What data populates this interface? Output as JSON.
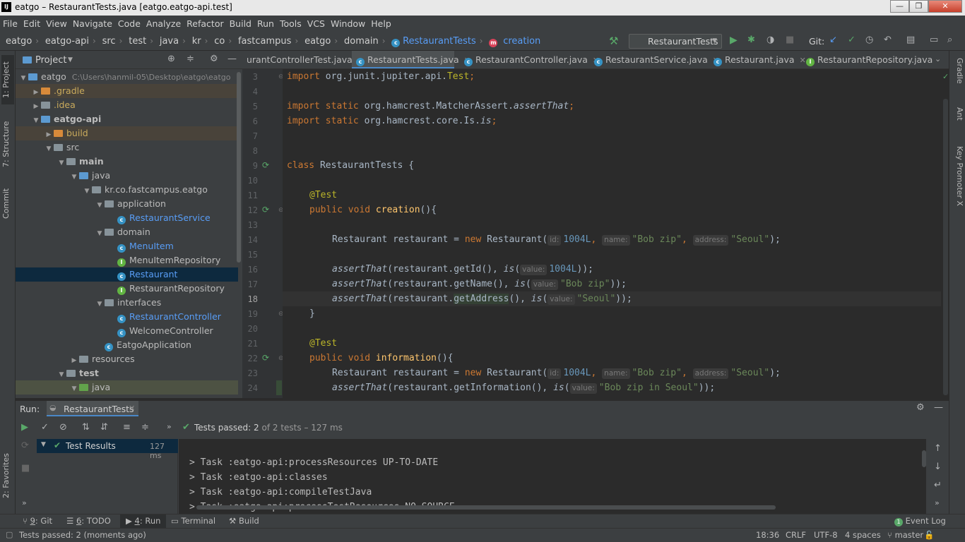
{
  "titlebar": {
    "logo": "IJ",
    "title": "eatgo – RestaurantTests.java [eatgo.eatgo-api.test]",
    "min": "—",
    "max": "❐",
    "close": "✕"
  },
  "menu": [
    "File",
    "Edit",
    "View",
    "Navigate",
    "Code",
    "Analyze",
    "Refactor",
    "Build",
    "Run",
    "Tools",
    "VCS",
    "Window",
    "Help"
  ],
  "breadcrumbs": [
    "eatgo",
    "eatgo-api",
    "src",
    "test",
    "java",
    "kr",
    "co",
    "fastcampus",
    "eatgo",
    "domain",
    "RestaurantTests",
    "creation"
  ],
  "run_config": "RestaurantTests",
  "git_label": "Git:",
  "project_panel": {
    "title": "Project",
    "root_path": "C:\\Users\\hanmil-05\\Desktop\\eatgo\\eatgo",
    "tree": [
      {
        "label": "eatgo",
        "path": "C:\\Users\\hanmil-05\\Desktop\\eatgo\\eatgo"
      },
      {
        "label": ".gradle"
      },
      {
        "label": ".idea"
      },
      {
        "label": "eatgo-api"
      },
      {
        "label": "build"
      },
      {
        "label": "src"
      },
      {
        "label": "main"
      },
      {
        "label": "java"
      },
      {
        "label": "kr.co.fastcampus.eatgo"
      },
      {
        "label": "application"
      },
      {
        "label": "RestaurantService"
      },
      {
        "label": "domain"
      },
      {
        "label": "MenuItem"
      },
      {
        "label": "MenuItemRepository"
      },
      {
        "label": "Restaurant"
      },
      {
        "label": "RestaurantRepository"
      },
      {
        "label": "interfaces"
      },
      {
        "label": "RestaurantController"
      },
      {
        "label": "WelcomeController"
      },
      {
        "label": "EatgoApplication"
      },
      {
        "label": "resources"
      },
      {
        "label": "test"
      },
      {
        "label": "java"
      }
    ]
  },
  "left_tabs": {
    "project": "1: Project",
    "structure": "7: Structure",
    "commit": "Commit",
    "favorites": "2: Favorites"
  },
  "right_tabs": {
    "gradle": "Gradle",
    "ant": "Ant",
    "key_promoter": "Key Promoter X"
  },
  "tabs": [
    {
      "label": "urantControllerTest.java"
    },
    {
      "label": "RestaurantTests.java"
    },
    {
      "label": "RestaurantController.java"
    },
    {
      "label": "RestaurantService.java"
    },
    {
      "label": "Restaurant.java"
    },
    {
      "label": "RestaurantRepository.java"
    }
  ],
  "code": {
    "line_numbers": [
      "3",
      "4",
      "5",
      "6",
      "7",
      "8",
      "9",
      "10",
      "11",
      "12",
      "13",
      "14",
      "15",
      "16",
      "17",
      "18",
      "19",
      "20",
      "21",
      "22",
      "23",
      "24"
    ],
    "l3": {
      "kw": "import",
      "rest": " org.junit.jupiter.api.",
      "cls": "Test",
      ";": ";"
    },
    "l5": {
      "kw": "import static",
      "rest": " org.hamcrest.MatcherAssert.",
      "m": "assertThat",
      ";": ";"
    },
    "l6": {
      "kw": "import static",
      "rest": " org.hamcrest.core.Is.",
      "m": "is",
      ";": ";"
    },
    "l9": {
      "kw": "class",
      "rest": " RestaurantTests {"
    },
    "ann": "@Test",
    "l12": {
      "kw": "public void",
      "fn": " creation",
      "rest": "(){"
    },
    "l14": {
      "a": "Restaurant restaurant = ",
      "kw": "new",
      "b": " Restaurant(",
      "h1": "id:",
      "n1": "1004L",
      "c": ", ",
      "h2": "name:",
      "s1": "\"Bob zip\"",
      "d": ", ",
      "h3": "address:",
      "s2": "\"Seoul\"",
      "e": ");"
    },
    "l16": {
      "m": "assertThat",
      "a": "(restaurant.getId(), ",
      "m2": "is",
      "b": "(",
      "h": "value:",
      "v": "1004L",
      "c": "));"
    },
    "l17": {
      "m": "assertThat",
      "a": "(restaurant.getName(), ",
      "m2": "is",
      "b": "(",
      "h": "value:",
      "v": "\"Bob zip\"",
      "c": "));"
    },
    "l18": {
      "m": "assertThat",
      "a": "(restaurant.",
      "g": "getAddress",
      "a2": "(), ",
      "m2": "is",
      "b": "(",
      "h": "value:",
      "v": "\"Seoul\"",
      "c": "));"
    },
    "l19": "}",
    "l22": {
      "kw": "public void",
      "fn": " information",
      "rest": "(){"
    },
    "l23": {
      "a": "Restaurant restaurant = ",
      "kw": "new",
      "b": " Restaurant(",
      "h1": "id:",
      "n1": "1004L",
      "c": ", ",
      "h2": "name:",
      "s1": "\"Bob zip\"",
      "d": ", ",
      "h3": "address:",
      "s2": "\"Seoul\"",
      "e": ");"
    },
    "l24": {
      "m": "assertThat",
      "a": "(restaurant.getInformation(), ",
      "m2": "is",
      "b": "(",
      "h": "value:",
      "v": "\"Bob zip in Seoul\"",
      "c": "));"
    }
  },
  "run": {
    "label": "Run:",
    "config": "RestaurantTests",
    "tests_passed": "Tests passed:",
    "passed_count": "2",
    "of_text": "of 2 tests – 127 ms",
    "test_results": "Test Results",
    "test_time": "127 ms",
    "console": [
      "> Task :eatgo-api:processResources UP-TO-DATE",
      "> Task :eatgo-api:classes",
      "> Task :eatgo-api:compileTestJava",
      "> Task :eatgo-api:processTestResources NO-SOURCE"
    ]
  },
  "bottom_tabs": {
    "git_num": "9",
    "git": ": Git",
    "todo_num": "6",
    "todo": ": TODO",
    "run_num": "4",
    "run": ": Run",
    "terminal": "Terminal",
    "build": "Build",
    "event_log": "Event Log",
    "event_count": "1"
  },
  "status": {
    "message": "Tests passed: 2 (moments ago)",
    "position": "18:36",
    "line_sep": "CRLF",
    "encoding": "UTF-8",
    "indent": "4 spaces",
    "branch": "master"
  },
  "colors": {
    "accent": "#4a88c7",
    "keyword": "#cc7832",
    "string": "#6a8759",
    "number": "#6897bb",
    "annotation": "#bbb529",
    "success": "#59a869"
  }
}
